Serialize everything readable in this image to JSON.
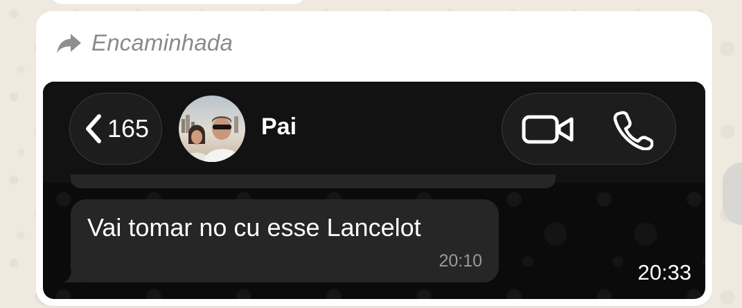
{
  "forwarded": {
    "label": "Encaminhada",
    "icon": "forward-arrow-icon"
  },
  "screenshot": {
    "header": {
      "back_count": "165",
      "back_icon": "chevron-left-icon",
      "contact_name": "Pai",
      "actions": [
        {
          "icon": "video-camera-icon"
        },
        {
          "icon": "phone-icon"
        }
      ]
    },
    "message": {
      "text": "Vai tomar no cu esse Lancelot",
      "time": "20:10"
    }
  },
  "bubble_time": "20:33",
  "colors": {
    "chat_background": "#efe9df",
    "bubble": "#ffffff",
    "forward_text": "#8a8a8a",
    "screenshot_background": "#0b0b0b",
    "message_bubble": "#262626"
  }
}
